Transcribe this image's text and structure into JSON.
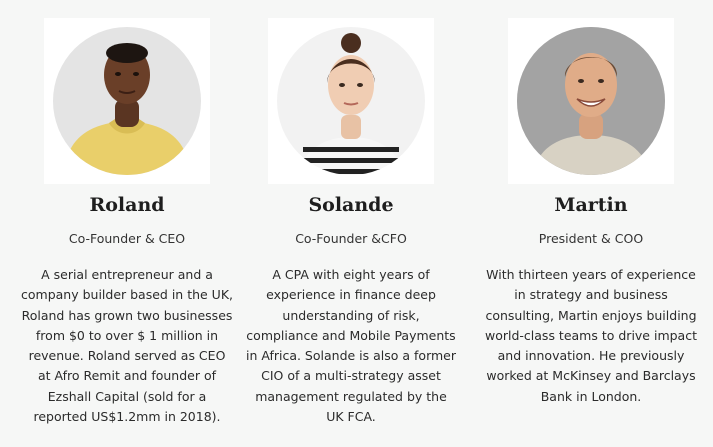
{
  "team": [
    {
      "name": "Roland",
      "role": "Co-Founder & CEO",
      "bio": "A serial entrepreneur and a company builder based in the UK, Roland has grown two businesses from $0 to over $ 1 million in revenue. Roland served as CEO at Afro Remit and founder of Ezshall Capital (sold for a reported US$1.2mm in 2018).",
      "photo_bg": "#e4e4e4"
    },
    {
      "name": "Solande",
      "role": "Co-Founder &CFO",
      "bio": "A CPA with eight years of experience in finance deep understanding of risk, compliance and Mobile Payments in Africa. Solande is also a former CIO of a multi-strategy asset management regulated by the UK FCA.",
      "photo_bg": "#f2f2f2"
    },
    {
      "name": "Martin",
      "role": "President & COO",
      "bio": "With thirteen years of experience in strategy and business consulting, Martin enjoys building world-class teams to drive impact and innovation. He previously worked at McKinsey and Barclays Bank in London.",
      "photo_bg": "#9a9a9a"
    }
  ]
}
